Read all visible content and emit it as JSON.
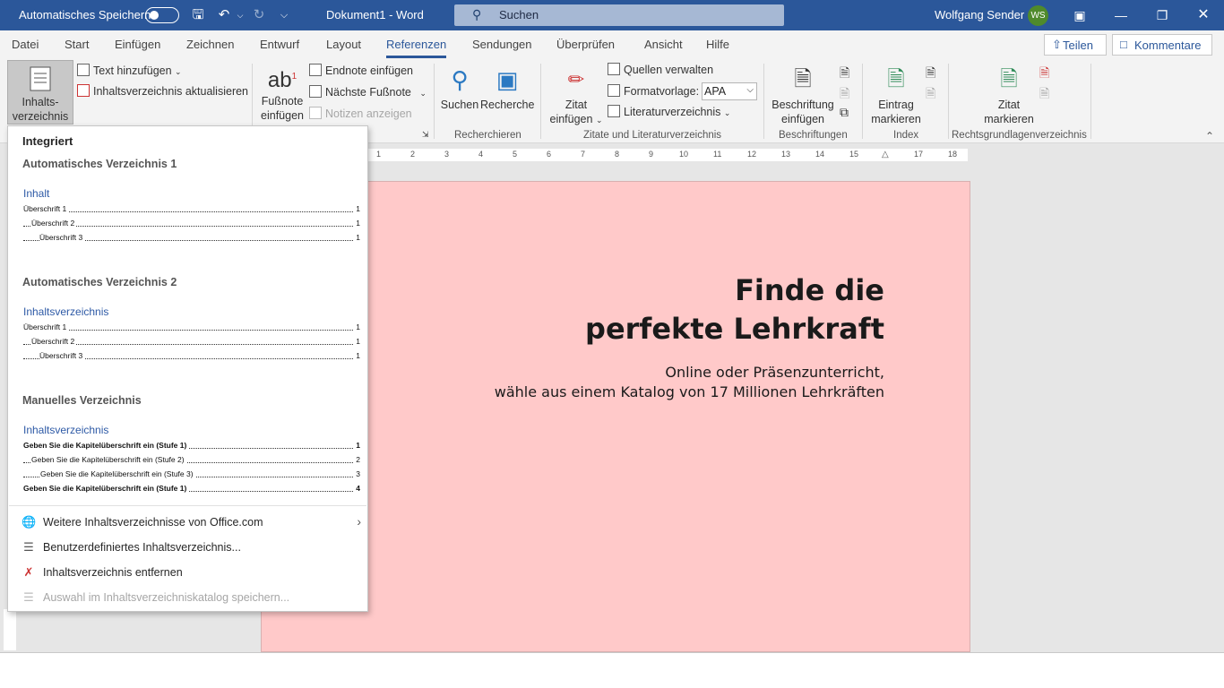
{
  "titlebar": {
    "autosave_label": "Automatisches Speichern",
    "document_title": "Dokument1  -  Word",
    "search_placeholder": "Suchen",
    "user_name": "Wolfgang Sender",
    "user_initials": "WS",
    "accent_color": "#2b579a"
  },
  "menu": {
    "tabs": [
      "Datei",
      "Start",
      "Einfügen",
      "Zeichnen",
      "Entwurf",
      "Layout",
      "Referenzen",
      "Sendungen",
      "Überprüfen",
      "Ansicht",
      "Hilfe"
    ],
    "active_tab": "Referenzen",
    "share_label": "Teilen",
    "comments_label": "Kommentare"
  },
  "ribbon": {
    "toc": {
      "button_label_1": "Inhalts-",
      "button_label_2": "verzeichnis",
      "add_text": "Text hinzufügen",
      "update_toc": "Inhaltsverzeichnis aktualisieren"
    },
    "footnotes": {
      "insert_label_1": "Fußnote",
      "insert_label_2": "einfügen",
      "endnote": "Endnote einfügen",
      "next_footnote": "Nächste Fußnote",
      "show_notes": "Notizen anzeigen"
    },
    "research": {
      "search": "Suchen",
      "research": "Recherche",
      "group_label": "Recherchieren"
    },
    "citations": {
      "insert_citation_1": "Zitat",
      "insert_citation_2": "einfügen",
      "manage_sources": "Quellen verwalten",
      "style_label": "Formatvorlage:",
      "style_value": "APA",
      "bibliography": "Literaturverzeichnis",
      "group_label": "Zitate und Literaturverzeichnis"
    },
    "captions": {
      "insert_caption_1": "Beschriftung",
      "insert_caption_2": "einfügen",
      "group_label": "Beschriftungen"
    },
    "index": {
      "mark_entry_1": "Eintrag",
      "mark_entry_2": "markieren",
      "group_label": "Index"
    },
    "authorities": {
      "mark_citation_1": "Zitat",
      "mark_citation_2": "markieren",
      "group_label": "Rechtsgrundlagenverzeichnis"
    }
  },
  "ruler": {
    "marks": [
      "1",
      "2",
      "3",
      "4",
      "5",
      "6",
      "7",
      "8",
      "9",
      "10",
      "11",
      "12",
      "13",
      "14",
      "15",
      "17",
      "18"
    ]
  },
  "document": {
    "headline_1": "Finde die",
    "headline_2": "perfekte Lehrkraft",
    "sub_1": "Online oder Präsenzunterricht,",
    "sub_2": "wähle aus einem Katalog von 17 Millionen Lehrkräften",
    "page_color": "#ffc9c9"
  },
  "dropdown": {
    "header": "Integriert",
    "sections": [
      {
        "title": "Automatisches Verzeichnis 1",
        "preview_title": "Inhalt",
        "lines": [
          {
            "text": "Überschrift 1",
            "page": "1"
          },
          {
            "text": "Überschrift 2",
            "page": "1"
          },
          {
            "text": "Überschrift 3",
            "page": "1"
          }
        ]
      },
      {
        "title": "Automatisches Verzeichnis 2",
        "preview_title": "Inhaltsverzeichnis",
        "lines": [
          {
            "text": "Überschrift 1",
            "page": "1"
          },
          {
            "text": "Überschrift 2",
            "page": "1"
          },
          {
            "text": "Überschrift 3",
            "page": "1"
          }
        ]
      },
      {
        "title": "Manuelles Verzeichnis",
        "preview_title": "Inhaltsverzeichnis",
        "lines": [
          {
            "text": "Geben Sie die Kapitelüberschrift ein (Stufe 1)",
            "page": "1"
          },
          {
            "text": "Geben Sie die Kapitelüberschrift ein (Stufe 2)",
            "page": "2"
          },
          {
            "text": "Geben Sie die Kapitelüberschrift ein (Stufe 3)",
            "page": "3"
          },
          {
            "text": "Geben Sie die Kapitelüberschrift ein (Stufe 1)",
            "page": "4"
          }
        ]
      }
    ],
    "actions": {
      "more_office": "Weitere Inhaltsverzeichnisse von Office.com",
      "custom_toc": "Benutzerdefiniertes Inhaltsverzeichnis...",
      "remove_toc": "Inhaltsverzeichnis entfernen",
      "save_selection": "Auswahl im Inhaltsverzeichniskatalog speichern..."
    }
  }
}
